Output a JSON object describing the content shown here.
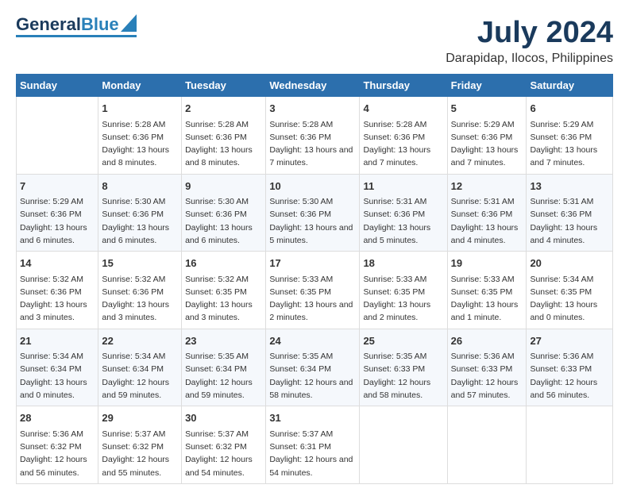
{
  "header": {
    "logo_line1": "General",
    "logo_line2": "Blue",
    "month_year": "July 2024",
    "location": "Darapidap, Ilocos, Philippines"
  },
  "days_of_week": [
    "Sunday",
    "Monday",
    "Tuesday",
    "Wednesday",
    "Thursday",
    "Friday",
    "Saturday"
  ],
  "weeks": [
    [
      {
        "day": "",
        "sunrise": "",
        "sunset": "",
        "daylight": ""
      },
      {
        "day": "1",
        "sunrise": "Sunrise: 5:28 AM",
        "sunset": "Sunset: 6:36 PM",
        "daylight": "Daylight: 13 hours and 8 minutes."
      },
      {
        "day": "2",
        "sunrise": "Sunrise: 5:28 AM",
        "sunset": "Sunset: 6:36 PM",
        "daylight": "Daylight: 13 hours and 8 minutes."
      },
      {
        "day": "3",
        "sunrise": "Sunrise: 5:28 AM",
        "sunset": "Sunset: 6:36 PM",
        "daylight": "Daylight: 13 hours and 7 minutes."
      },
      {
        "day": "4",
        "sunrise": "Sunrise: 5:28 AM",
        "sunset": "Sunset: 6:36 PM",
        "daylight": "Daylight: 13 hours and 7 minutes."
      },
      {
        "day": "5",
        "sunrise": "Sunrise: 5:29 AM",
        "sunset": "Sunset: 6:36 PM",
        "daylight": "Daylight: 13 hours and 7 minutes."
      },
      {
        "day": "6",
        "sunrise": "Sunrise: 5:29 AM",
        "sunset": "Sunset: 6:36 PM",
        "daylight": "Daylight: 13 hours and 7 minutes."
      }
    ],
    [
      {
        "day": "7",
        "sunrise": "Sunrise: 5:29 AM",
        "sunset": "Sunset: 6:36 PM",
        "daylight": "Daylight: 13 hours and 6 minutes."
      },
      {
        "day": "8",
        "sunrise": "Sunrise: 5:30 AM",
        "sunset": "Sunset: 6:36 PM",
        "daylight": "Daylight: 13 hours and 6 minutes."
      },
      {
        "day": "9",
        "sunrise": "Sunrise: 5:30 AM",
        "sunset": "Sunset: 6:36 PM",
        "daylight": "Daylight: 13 hours and 6 minutes."
      },
      {
        "day": "10",
        "sunrise": "Sunrise: 5:30 AM",
        "sunset": "Sunset: 6:36 PM",
        "daylight": "Daylight: 13 hours and 5 minutes."
      },
      {
        "day": "11",
        "sunrise": "Sunrise: 5:31 AM",
        "sunset": "Sunset: 6:36 PM",
        "daylight": "Daylight: 13 hours and 5 minutes."
      },
      {
        "day": "12",
        "sunrise": "Sunrise: 5:31 AM",
        "sunset": "Sunset: 6:36 PM",
        "daylight": "Daylight: 13 hours and 4 minutes."
      },
      {
        "day": "13",
        "sunrise": "Sunrise: 5:31 AM",
        "sunset": "Sunset: 6:36 PM",
        "daylight": "Daylight: 13 hours and 4 minutes."
      }
    ],
    [
      {
        "day": "14",
        "sunrise": "Sunrise: 5:32 AM",
        "sunset": "Sunset: 6:36 PM",
        "daylight": "Daylight: 13 hours and 3 minutes."
      },
      {
        "day": "15",
        "sunrise": "Sunrise: 5:32 AM",
        "sunset": "Sunset: 6:36 PM",
        "daylight": "Daylight: 13 hours and 3 minutes."
      },
      {
        "day": "16",
        "sunrise": "Sunrise: 5:32 AM",
        "sunset": "Sunset: 6:35 PM",
        "daylight": "Daylight: 13 hours and 3 minutes."
      },
      {
        "day": "17",
        "sunrise": "Sunrise: 5:33 AM",
        "sunset": "Sunset: 6:35 PM",
        "daylight": "Daylight: 13 hours and 2 minutes."
      },
      {
        "day": "18",
        "sunrise": "Sunrise: 5:33 AM",
        "sunset": "Sunset: 6:35 PM",
        "daylight": "Daylight: 13 hours and 2 minutes."
      },
      {
        "day": "19",
        "sunrise": "Sunrise: 5:33 AM",
        "sunset": "Sunset: 6:35 PM",
        "daylight": "Daylight: 13 hours and 1 minute."
      },
      {
        "day": "20",
        "sunrise": "Sunrise: 5:34 AM",
        "sunset": "Sunset: 6:35 PM",
        "daylight": "Daylight: 13 hours and 0 minutes."
      }
    ],
    [
      {
        "day": "21",
        "sunrise": "Sunrise: 5:34 AM",
        "sunset": "Sunset: 6:34 PM",
        "daylight": "Daylight: 13 hours and 0 minutes."
      },
      {
        "day": "22",
        "sunrise": "Sunrise: 5:34 AM",
        "sunset": "Sunset: 6:34 PM",
        "daylight": "Daylight: 12 hours and 59 minutes."
      },
      {
        "day": "23",
        "sunrise": "Sunrise: 5:35 AM",
        "sunset": "Sunset: 6:34 PM",
        "daylight": "Daylight: 12 hours and 59 minutes."
      },
      {
        "day": "24",
        "sunrise": "Sunrise: 5:35 AM",
        "sunset": "Sunset: 6:34 PM",
        "daylight": "Daylight: 12 hours and 58 minutes."
      },
      {
        "day": "25",
        "sunrise": "Sunrise: 5:35 AM",
        "sunset": "Sunset: 6:33 PM",
        "daylight": "Daylight: 12 hours and 58 minutes."
      },
      {
        "day": "26",
        "sunrise": "Sunrise: 5:36 AM",
        "sunset": "Sunset: 6:33 PM",
        "daylight": "Daylight: 12 hours and 57 minutes."
      },
      {
        "day": "27",
        "sunrise": "Sunrise: 5:36 AM",
        "sunset": "Sunset: 6:33 PM",
        "daylight": "Daylight: 12 hours and 56 minutes."
      }
    ],
    [
      {
        "day": "28",
        "sunrise": "Sunrise: 5:36 AM",
        "sunset": "Sunset: 6:32 PM",
        "daylight": "Daylight: 12 hours and 56 minutes."
      },
      {
        "day": "29",
        "sunrise": "Sunrise: 5:37 AM",
        "sunset": "Sunset: 6:32 PM",
        "daylight": "Daylight: 12 hours and 55 minutes."
      },
      {
        "day": "30",
        "sunrise": "Sunrise: 5:37 AM",
        "sunset": "Sunset: 6:32 PM",
        "daylight": "Daylight: 12 hours and 54 minutes."
      },
      {
        "day": "31",
        "sunrise": "Sunrise: 5:37 AM",
        "sunset": "Sunset: 6:31 PM",
        "daylight": "Daylight: 12 hours and 54 minutes."
      },
      {
        "day": "",
        "sunrise": "",
        "sunset": "",
        "daylight": ""
      },
      {
        "day": "",
        "sunrise": "",
        "sunset": "",
        "daylight": ""
      },
      {
        "day": "",
        "sunrise": "",
        "sunset": "",
        "daylight": ""
      }
    ]
  ]
}
